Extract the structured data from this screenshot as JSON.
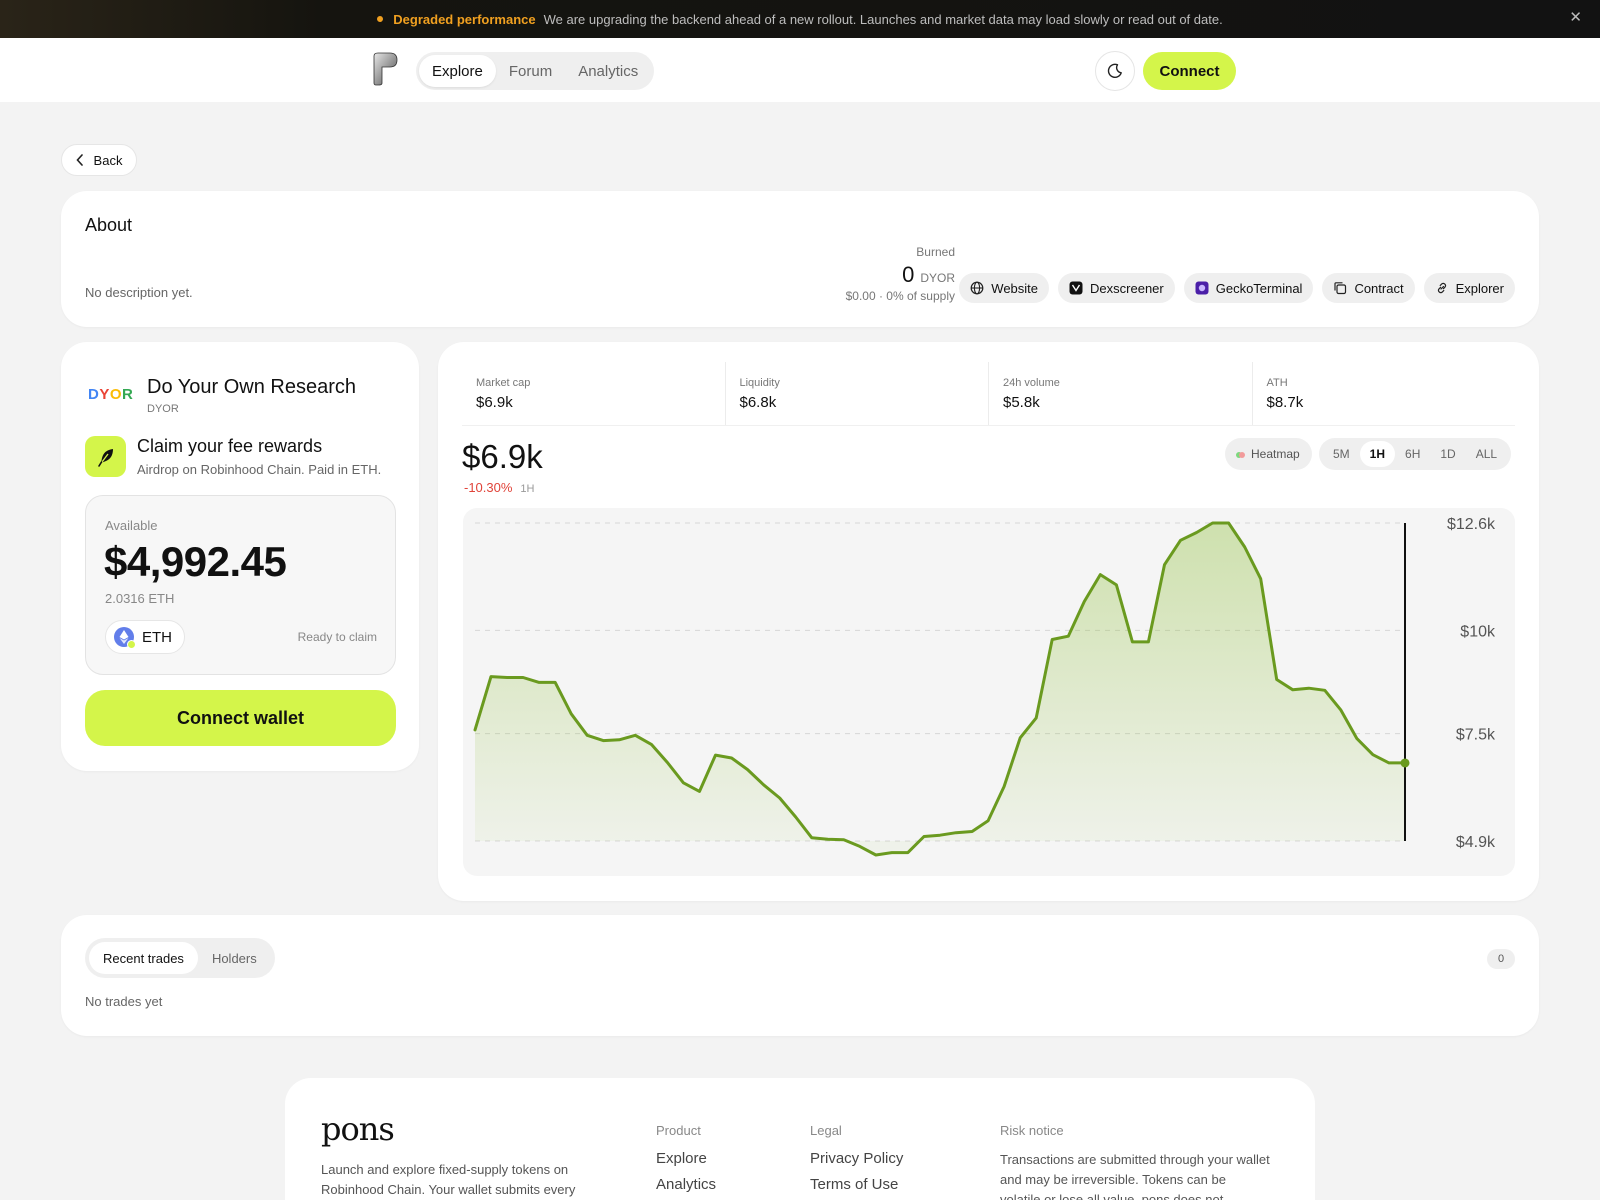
{
  "banner": {
    "title": "Degraded performance",
    "message": "We are upgrading the backend ahead of a new rollout. Launches and market data may load slowly or read out of date.",
    "close_glyph": "✕"
  },
  "header": {
    "nav": [
      "Explore",
      "Forum",
      "Analytics"
    ],
    "active_nav": "Explore",
    "connect_label": "Connect",
    "theme_icon": "moon-icon"
  },
  "back_label": "Back",
  "about": {
    "title": "About",
    "description": "No description yet.",
    "burned_label": "Burned",
    "burned_amount": "0",
    "burned_ticker": "DYOR",
    "burned_sub": "$0.00 · 0% of supply",
    "links": [
      "Website",
      "Dexscreener",
      "GeckoTerminal",
      "Contract",
      "Explorer"
    ]
  },
  "token": {
    "logo_text": "DYOR",
    "name": "Do Your Own Research",
    "ticker": "DYOR",
    "claim_title": "Claim your fee rewards",
    "claim_sub": "Airdrop on Robinhood Chain. Paid in ETH.",
    "available_label": "Available",
    "available_amount": "$4,992.45",
    "eth_amount": "2.0316 ETH",
    "asset": "ETH",
    "status": "Ready to claim",
    "wallet_button": "Connect wallet"
  },
  "market": {
    "stats": [
      {
        "label": "Market cap",
        "value": "$6.9k"
      },
      {
        "label": "Liquidity",
        "value": "$6.8k"
      },
      {
        "label": "24h volume",
        "value": "$5.8k"
      },
      {
        "label": "ATH",
        "value": "$8.7k"
      }
    ],
    "price": "$6.9k",
    "change": "-10.30%",
    "change_tf": "1H",
    "heatmap_label": "Heatmap",
    "timeframes": [
      "5M",
      "1H",
      "6H",
      "1D",
      "ALL"
    ],
    "active_tf": "1H"
  },
  "chart_data": {
    "type": "area",
    "ylim": [
      4.9,
      12.6
    ],
    "y_unit": "k",
    "y_tick_values": [
      12.6,
      10,
      7.5,
      4.9
    ],
    "y_ticks": [
      "$12.6k",
      "$10k",
      "$7.5k",
      "$4.9k"
    ],
    "grid": true,
    "values": [
      7.59,
      8.88,
      8.86,
      8.86,
      8.74,
      8.74,
      7.98,
      7.46,
      7.33,
      7.35,
      7.46,
      7.24,
      6.8,
      6.31,
      6.1,
      6.98,
      6.91,
      6.63,
      6.26,
      5.94,
      5.48,
      4.98,
      4.94,
      4.93,
      4.77,
      4.56,
      4.62,
      4.62,
      5.01,
      5.04,
      5.1,
      5.13,
      5.39,
      6.22,
      7.4,
      7.88,
      9.78,
      9.86,
      10.7,
      11.35,
      11.1,
      9.72,
      9.72,
      11.59,
      12.18,
      12.37,
      12.6,
      12.6,
      12.02,
      11.25,
      8.81,
      8.56,
      8.6,
      8.55,
      8.07,
      7.38,
      6.99,
      6.79,
      6.79
    ]
  },
  "trades": {
    "tabs": [
      "Recent trades",
      "Holders"
    ],
    "active": "Recent trades",
    "count": "0",
    "empty": "No trades yet"
  },
  "footer": {
    "brand": "pons",
    "tagline": "Launch and explore fixed-supply tokens on Robinhood Chain. Your wallet submits every",
    "product_title": "Product",
    "product_links": [
      "Explore",
      "Analytics"
    ],
    "legal_title": "Legal",
    "legal_links": [
      "Privacy Policy",
      "Terms of Use"
    ],
    "risk_title": "Risk notice",
    "risk_text": "Transactions are submitted through your wallet and may be irreversible. Tokens can be volatile or lose all value. pons does not"
  },
  "colors": {
    "accent": "#d4f54a",
    "line": "#6a9a1f",
    "negative": "#e0443a",
    "warning": "#f0a020"
  }
}
